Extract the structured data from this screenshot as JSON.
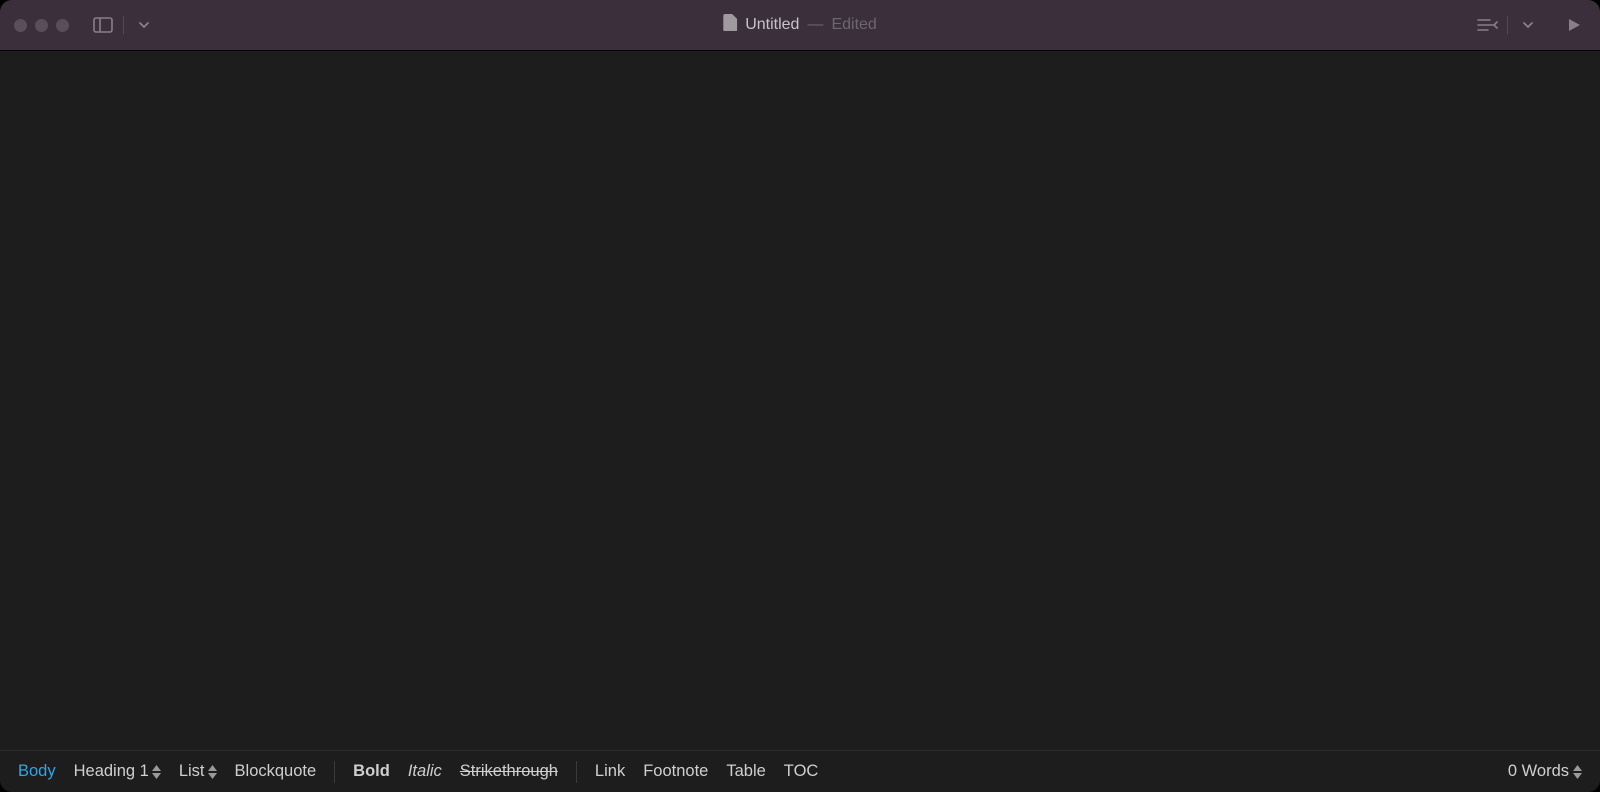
{
  "titlebar": {
    "title": "Untitled",
    "status": "Edited",
    "dash": "—"
  },
  "toolbar": {
    "body": "Body",
    "heading": "Heading 1",
    "list": "List",
    "blockquote": "Blockquote",
    "bold": "Bold",
    "italic": "Italic",
    "strike": "Strikethrough",
    "link": "Link",
    "footnote": "Footnote",
    "table": "Table",
    "toc": "TOC"
  },
  "status": {
    "word_count": "0 Words"
  }
}
